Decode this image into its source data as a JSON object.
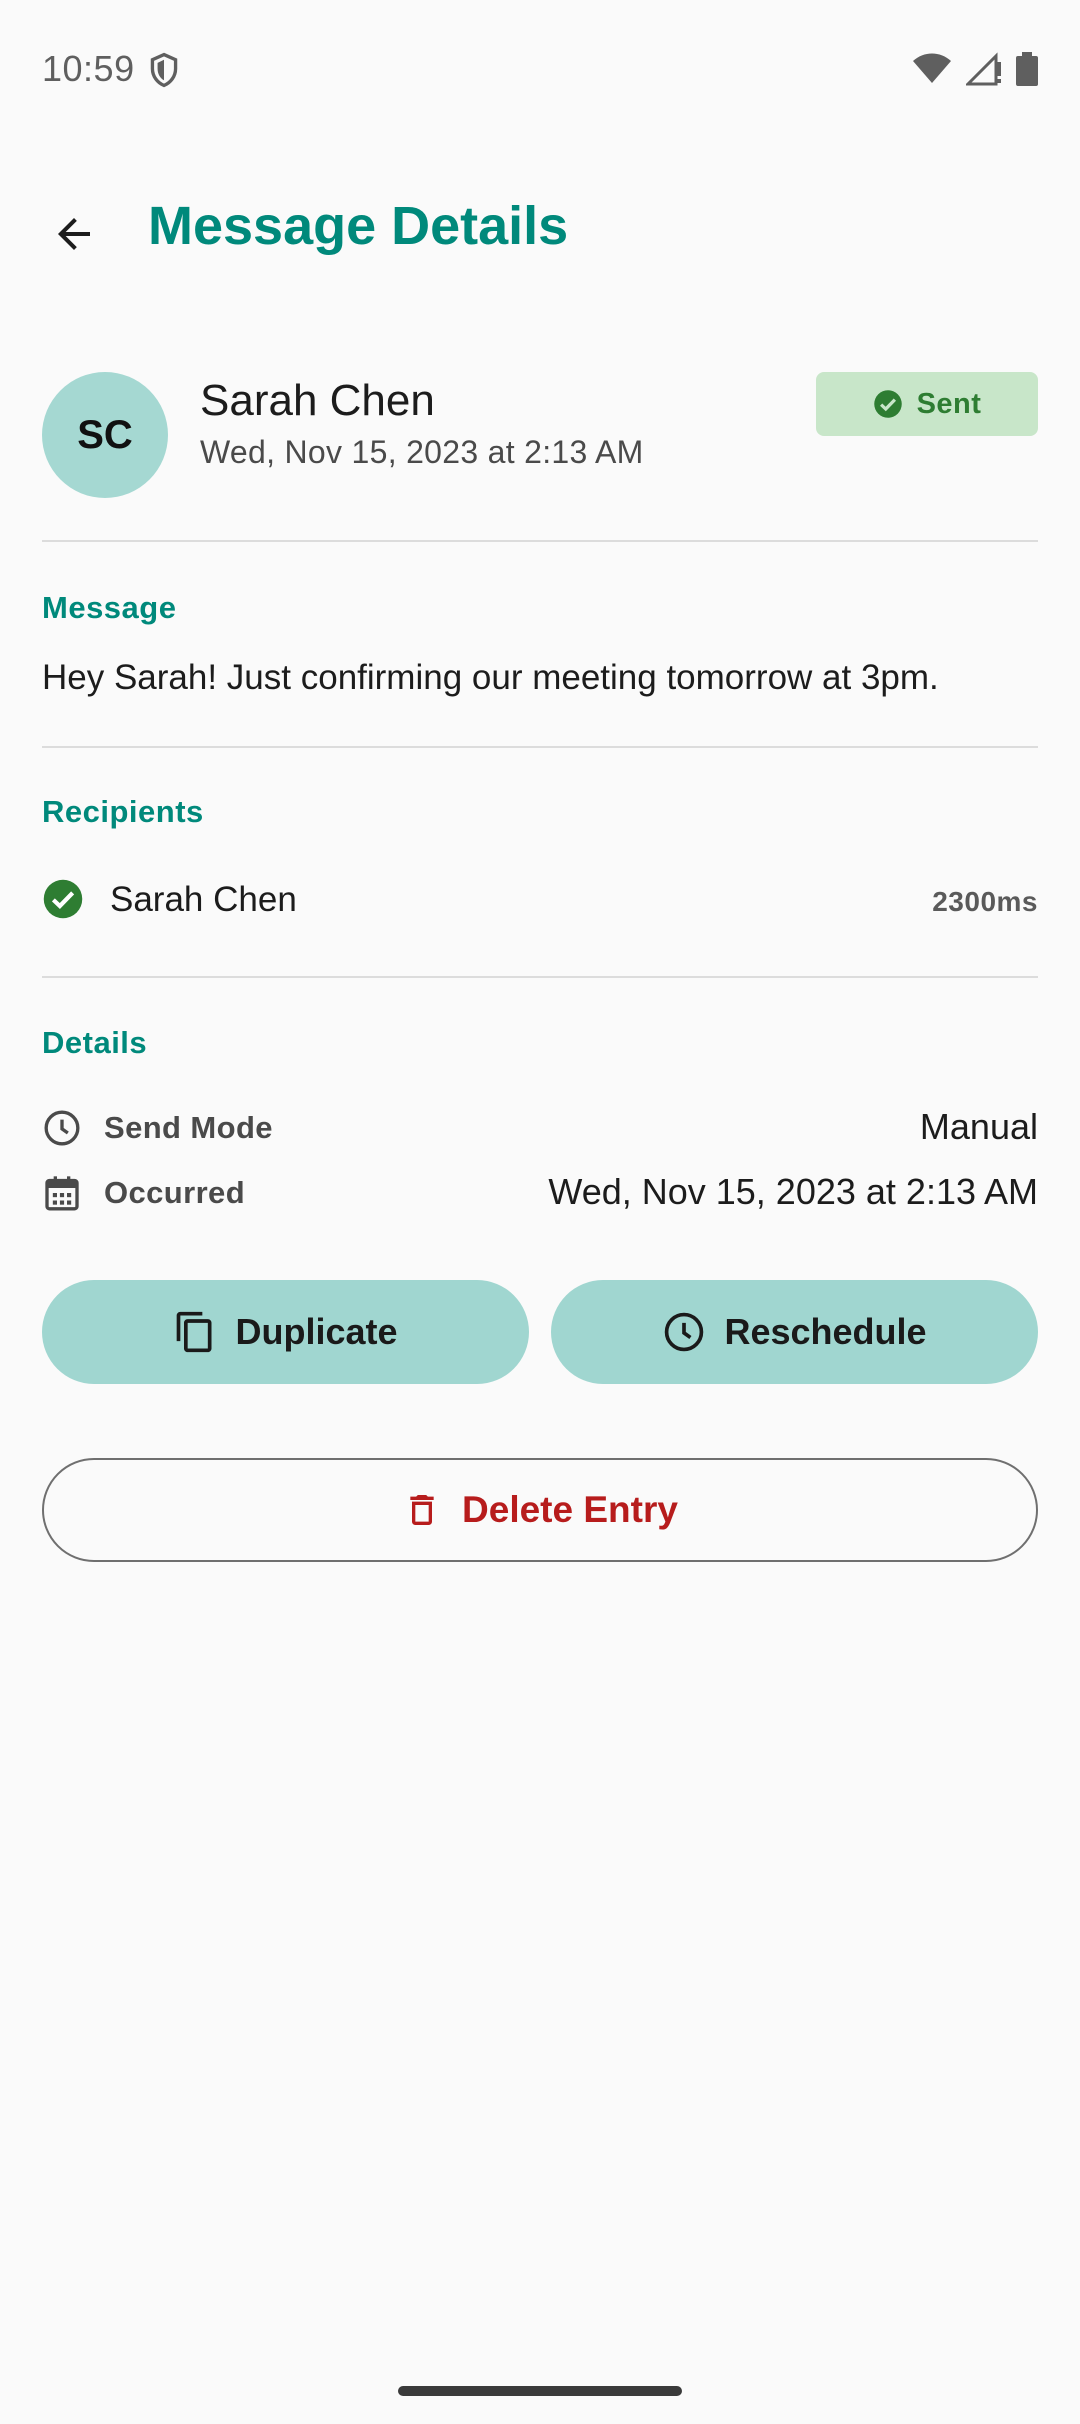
{
  "status_bar": {
    "time": "10:59"
  },
  "app_bar": {
    "title": "Message Details"
  },
  "header": {
    "avatar_initials": "SC",
    "contact_name": "Sarah Chen",
    "date": "Wed, Nov 15, 2023 at 2:13 AM",
    "status_label": "Sent"
  },
  "message": {
    "section_label": "Message",
    "text": "Hey Sarah! Just confirming our meeting tomorrow at 3pm."
  },
  "recipients": {
    "section_label": "Recipients",
    "items": [
      {
        "name": "Sarah Chen",
        "time": "2300ms"
      }
    ]
  },
  "details": {
    "section_label": "Details",
    "rows": [
      {
        "icon": "clock-icon",
        "label": "Send Mode",
        "value": "Manual"
      },
      {
        "icon": "calendar-icon",
        "label": "Occurred",
        "value": "Wed, Nov 15, 2023 at 2:13 AM"
      }
    ]
  },
  "actions": {
    "duplicate_label": "Duplicate",
    "reschedule_label": "Reschedule",
    "delete_label": "Delete Entry"
  },
  "colors": {
    "accent": "#00897b",
    "avatar_bg": "#a5d8d2",
    "badge_bg": "#c8e6c9",
    "badge_text": "#2e7d32",
    "button_bg": "#a0d6d0",
    "danger": "#b71c1c"
  }
}
